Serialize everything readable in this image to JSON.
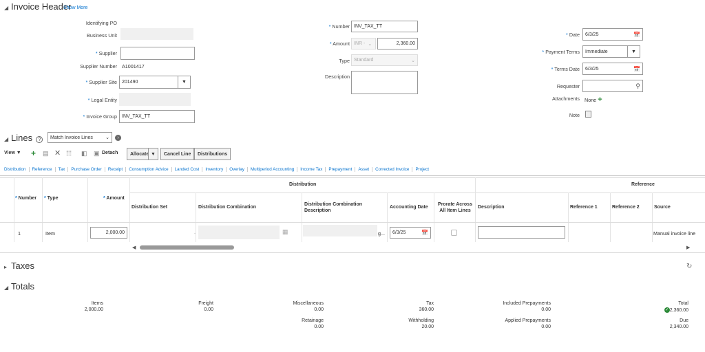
{
  "header": {
    "title": "Invoice Header",
    "show_more": "Show More",
    "identifying_po_label": "Identifying PO",
    "business_unit_label": "Business Unit",
    "supplier_label": "Supplier",
    "supplier_number_label": "Supplier Number",
    "supplier_number_value": "A1001417",
    "supplier_site_label": "Supplier Site",
    "supplier_site_value": "201490",
    "legal_entity_label": "Legal Entity",
    "invoice_group_label": "Invoice Group",
    "invoice_group_value": "INV_TAX_TT",
    "number_label": "Number",
    "number_value": "INV_TAX_TT",
    "amount_label": "Amount",
    "currency_value": "INR -",
    "amount_value": "2,360.00",
    "type_label": "Type",
    "type_value": "Standard",
    "description_label": "Description",
    "date_label": "Date",
    "date_value": "6/3/25",
    "payment_terms_label": "Payment Terms",
    "payment_terms_value": "Immediate",
    "terms_date_label": "Terms Date",
    "terms_date_value": "6/3/25",
    "requester_label": "Requester",
    "attachments_label": "Attachments",
    "attachments_value": "None",
    "note_label": "Note"
  },
  "lines": {
    "title": "Lines",
    "match_select": "Match Invoice Lines",
    "view_label": "View",
    "detach_label": "Detach",
    "allocate_label": "Allocate",
    "cancel_line_label": "Cancel Line",
    "distributions_label": "Distributions",
    "tabs": [
      "Distribution",
      "Reference",
      "Tax",
      "Purchase Order",
      "Receipt",
      "Consumption Advice",
      "Landed Cost",
      "Inventory",
      "Overlay",
      "Multiperiod Accounting",
      "Income Tax",
      "Prepayment",
      "Asset",
      "Corrected Invoice",
      "Project"
    ],
    "group_distribution": "Distribution",
    "group_reference": "Reference",
    "columns": {
      "number": "Number",
      "type": "Type",
      "amount": "Amount",
      "distribution_set": "Distribution Set",
      "distribution_combination": "Distribution Combination",
      "distribution_combination_description": "Distribution Combination Description",
      "accounting_date": "Accounting Date",
      "prorate": "Prorate Across All Item Lines",
      "description": "Description",
      "reference1": "Reference 1",
      "reference2": "Reference 2",
      "source": "Source"
    },
    "row": {
      "number": "1",
      "type": "Item",
      "amount": "2,000.00",
      "desc_suffix": "g...",
      "accounting_date": "6/3/25",
      "source": "Manual invoice line"
    }
  },
  "taxes": {
    "title": "Taxes"
  },
  "totals": {
    "title": "Totals",
    "items_label": "Items",
    "items_value": "2,000.00",
    "freight_label": "Freight",
    "freight_value": "0.00",
    "misc_label": "Miscellaneous",
    "misc_value": "0.00",
    "retainage_label": "Retainage",
    "retainage_value": "0.00",
    "tax_label": "Tax",
    "tax_value": "360.00",
    "withholding_label": "Withholding",
    "withholding_value": "20.00",
    "inc_prepay_label": "Included Prepayments",
    "inc_prepay_value": "0.00",
    "app_prepay_label": "Applied Prepayments",
    "app_prepay_value": "0.00",
    "total_label": "Total",
    "total_value": "2,360.00",
    "due_label": "Due",
    "due_value": "2,340.00"
  },
  "colors": {
    "link": "#0572ce",
    "check": "#2e8b3a"
  }
}
